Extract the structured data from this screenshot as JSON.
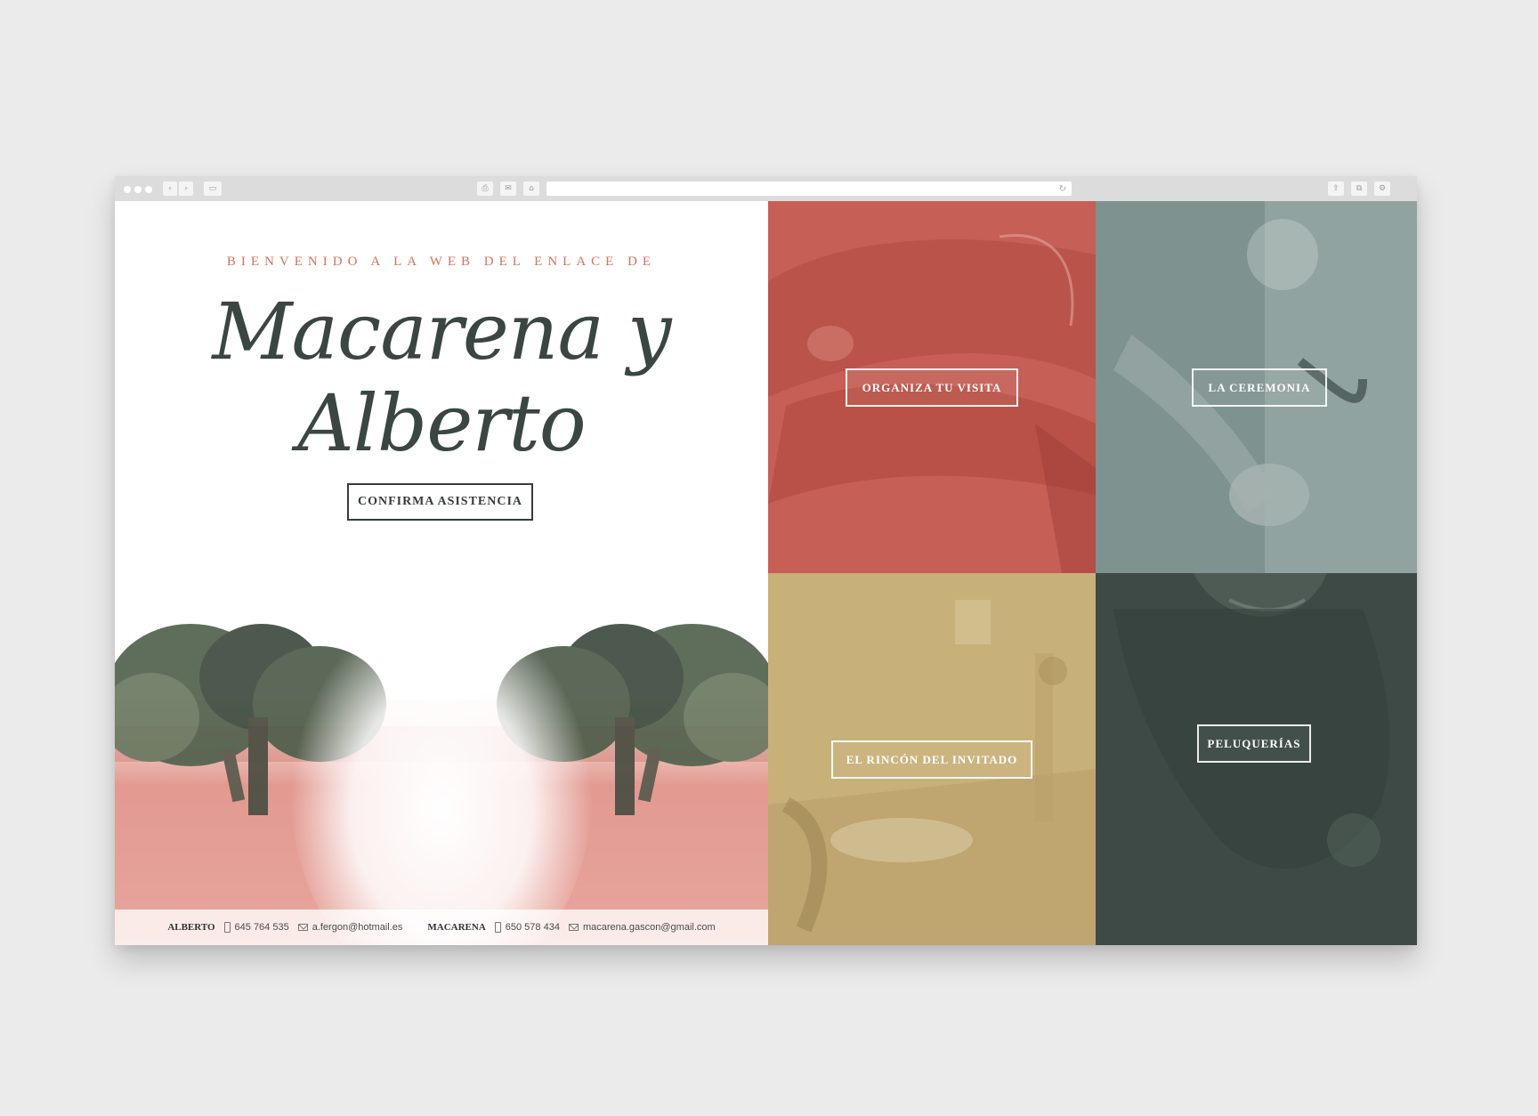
{
  "browser": {
    "buttons": [
      "‹",
      "›",
      "▭",
      "⎙",
      "✉",
      "⌂",
      "⇧",
      "⧉",
      "⚙"
    ],
    "reload_icon": "↻"
  },
  "hero": {
    "welcome": "BIENVENIDO A LA WEB DEL ENLACE DE",
    "names": "Macarena y Alberto",
    "confirm_button": "CONFIRMA ASISTENCIA"
  },
  "contacts": {
    "alberto": {
      "name": "ALBERTO",
      "phone": "645 764 535",
      "email": "a.fergon@hotmail.es"
    },
    "macarena": {
      "name": "MACARENA",
      "phone": "650 578 434",
      "email": "macarena.gascon@gmail.com"
    }
  },
  "tiles": [
    {
      "label": "ORGANIZA TU VISITA",
      "color": "#c65f55"
    },
    {
      "label": "LA CEREMONIA",
      "color": "#7e9290"
    },
    {
      "label": "EL RINCÓN DEL INVITADO",
      "color": "#c8b079"
    },
    {
      "label": "PELUQUERÍAS",
      "color": "#3d4a45"
    }
  ],
  "colors": {
    "accent": "#d2735f",
    "dark_text": "#333d39",
    "background": "#ebebeb"
  }
}
